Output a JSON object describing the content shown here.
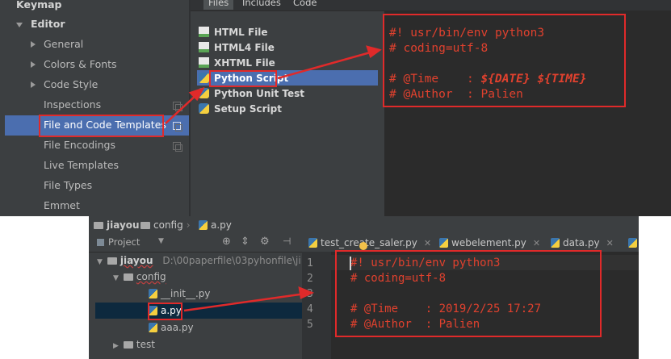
{
  "settings_tree": {
    "items": [
      {
        "label": "Keymap",
        "bold": true
      },
      {
        "label": "Editor",
        "bold": true
      },
      {
        "label": "General"
      },
      {
        "label": "Colors & Fonts"
      },
      {
        "label": "Code Style"
      },
      {
        "label": "Inspections"
      },
      {
        "label": "File and Code Templates"
      },
      {
        "label": "File Encodings"
      },
      {
        "label": "Live Templates"
      },
      {
        "label": "File Types"
      },
      {
        "label": "Emmet"
      }
    ]
  },
  "template_tabs": [
    "Files",
    "Includes",
    "Code"
  ],
  "templates": [
    {
      "label": "HTML File",
      "icon": "html-file-icon"
    },
    {
      "label": "HTML4 File",
      "icon": "html-file-icon"
    },
    {
      "label": "XHTML File",
      "icon": "html-file-icon"
    },
    {
      "label": "Python Script",
      "icon": "python-file-icon"
    },
    {
      "label": "Python Unit Test",
      "icon": "python-file-icon"
    },
    {
      "label": "Setup Script",
      "icon": "python-file-icon"
    }
  ],
  "template_code": {
    "line1": "#! usr/bin/env python3",
    "line2": "# coding=utf-8",
    "line3_prefix": "# @Time    : ",
    "line3_var1": "${DATE}",
    "line3_var2": "${TIME}",
    "line4": "# @Author  : Palien"
  },
  "breadcrumb": [
    "jiayou",
    "config",
    "a.py"
  ],
  "project_panel": {
    "title": "Project",
    "root_name": "jiayou",
    "root_path": "D:\\00paperfile\\03pyhonfile\\ji",
    "folder": "config",
    "files": [
      "__init__.py",
      "a.py",
      "aaa.py"
    ],
    "next_folder": "test"
  },
  "editor_tabs": [
    "test_create_saler.py",
    "webelement.py",
    "data.py"
  ],
  "editor": {
    "line_numbers": [
      "1",
      "2",
      "3",
      "4",
      "5"
    ],
    "lines": [
      "#! usr/bin/env python3",
      "# coding=utf-8",
      "",
      "# @Time    : 2019/2/25 17:27",
      "# @Author  : Palien"
    ]
  },
  "colors": {
    "annotation": "#e02a2a",
    "selection": "#4b6eaf",
    "code_text": "#e0412e"
  }
}
